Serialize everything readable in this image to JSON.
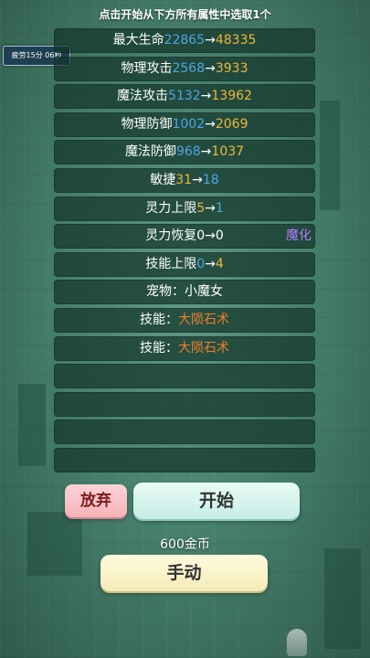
{
  "header": {
    "title": "点击开始从下方所有属性中选取1个"
  },
  "timer": {
    "label": "疲劳15分 06秒"
  },
  "rows": [
    {
      "label": "最大生命",
      "from": "22865",
      "arrow": "→",
      "to": "48335"
    },
    {
      "label": "物理攻击",
      "from": "2568",
      "arrow": "→",
      "to": "3933"
    },
    {
      "label": "魔法攻击",
      "from": "5132",
      "arrow": "→",
      "to": "13962"
    },
    {
      "label": "物理防御",
      "from": "1002",
      "arrow": "→",
      "to": "2069"
    },
    {
      "label": "魔法防御",
      "from": "968",
      "arrow": "→",
      "to": "1037"
    },
    {
      "label": "敏捷",
      "from": "31",
      "arrow": "→",
      "to": "18"
    },
    {
      "label": "灵力上限",
      "from": "5",
      "arrow": "→",
      "to": "1"
    },
    {
      "label": "灵力恢复",
      "from": "0",
      "arrow": "→",
      "to": "0",
      "tag": "魔化"
    },
    {
      "label": "技能上限",
      "from": "0",
      "arrow": "→",
      "to": "4"
    },
    {
      "label": "宠物：",
      "value": "小魔女"
    },
    {
      "label": "技能：",
      "value": "大陨石术"
    },
    {
      "label": "技能：",
      "value": "大陨石术"
    }
  ],
  "buttons": {
    "giveup": "放弃",
    "start": "开始",
    "manual": "手动"
  },
  "cost": "600金币",
  "colors": {
    "old_value": "#4ea6e6",
    "new_value": "#f2b53a",
    "skill": "#ef7d2c",
    "tag": "#b77cff"
  }
}
